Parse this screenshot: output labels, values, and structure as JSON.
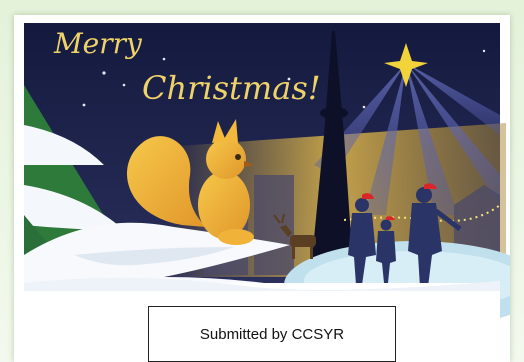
{
  "card": {
    "title_line1": "Merry",
    "title_line2": "Christmas!",
    "caption": "Submitted by CCSYR"
  },
  "colors": {
    "sky": "#1a1f45",
    "gold": "#e7c33a",
    "ice": "#bfe0ec",
    "tree": "#2d7a3a",
    "squirrel": "#e9a92f",
    "figures": "#2b3466",
    "hat": "#d8262b"
  }
}
